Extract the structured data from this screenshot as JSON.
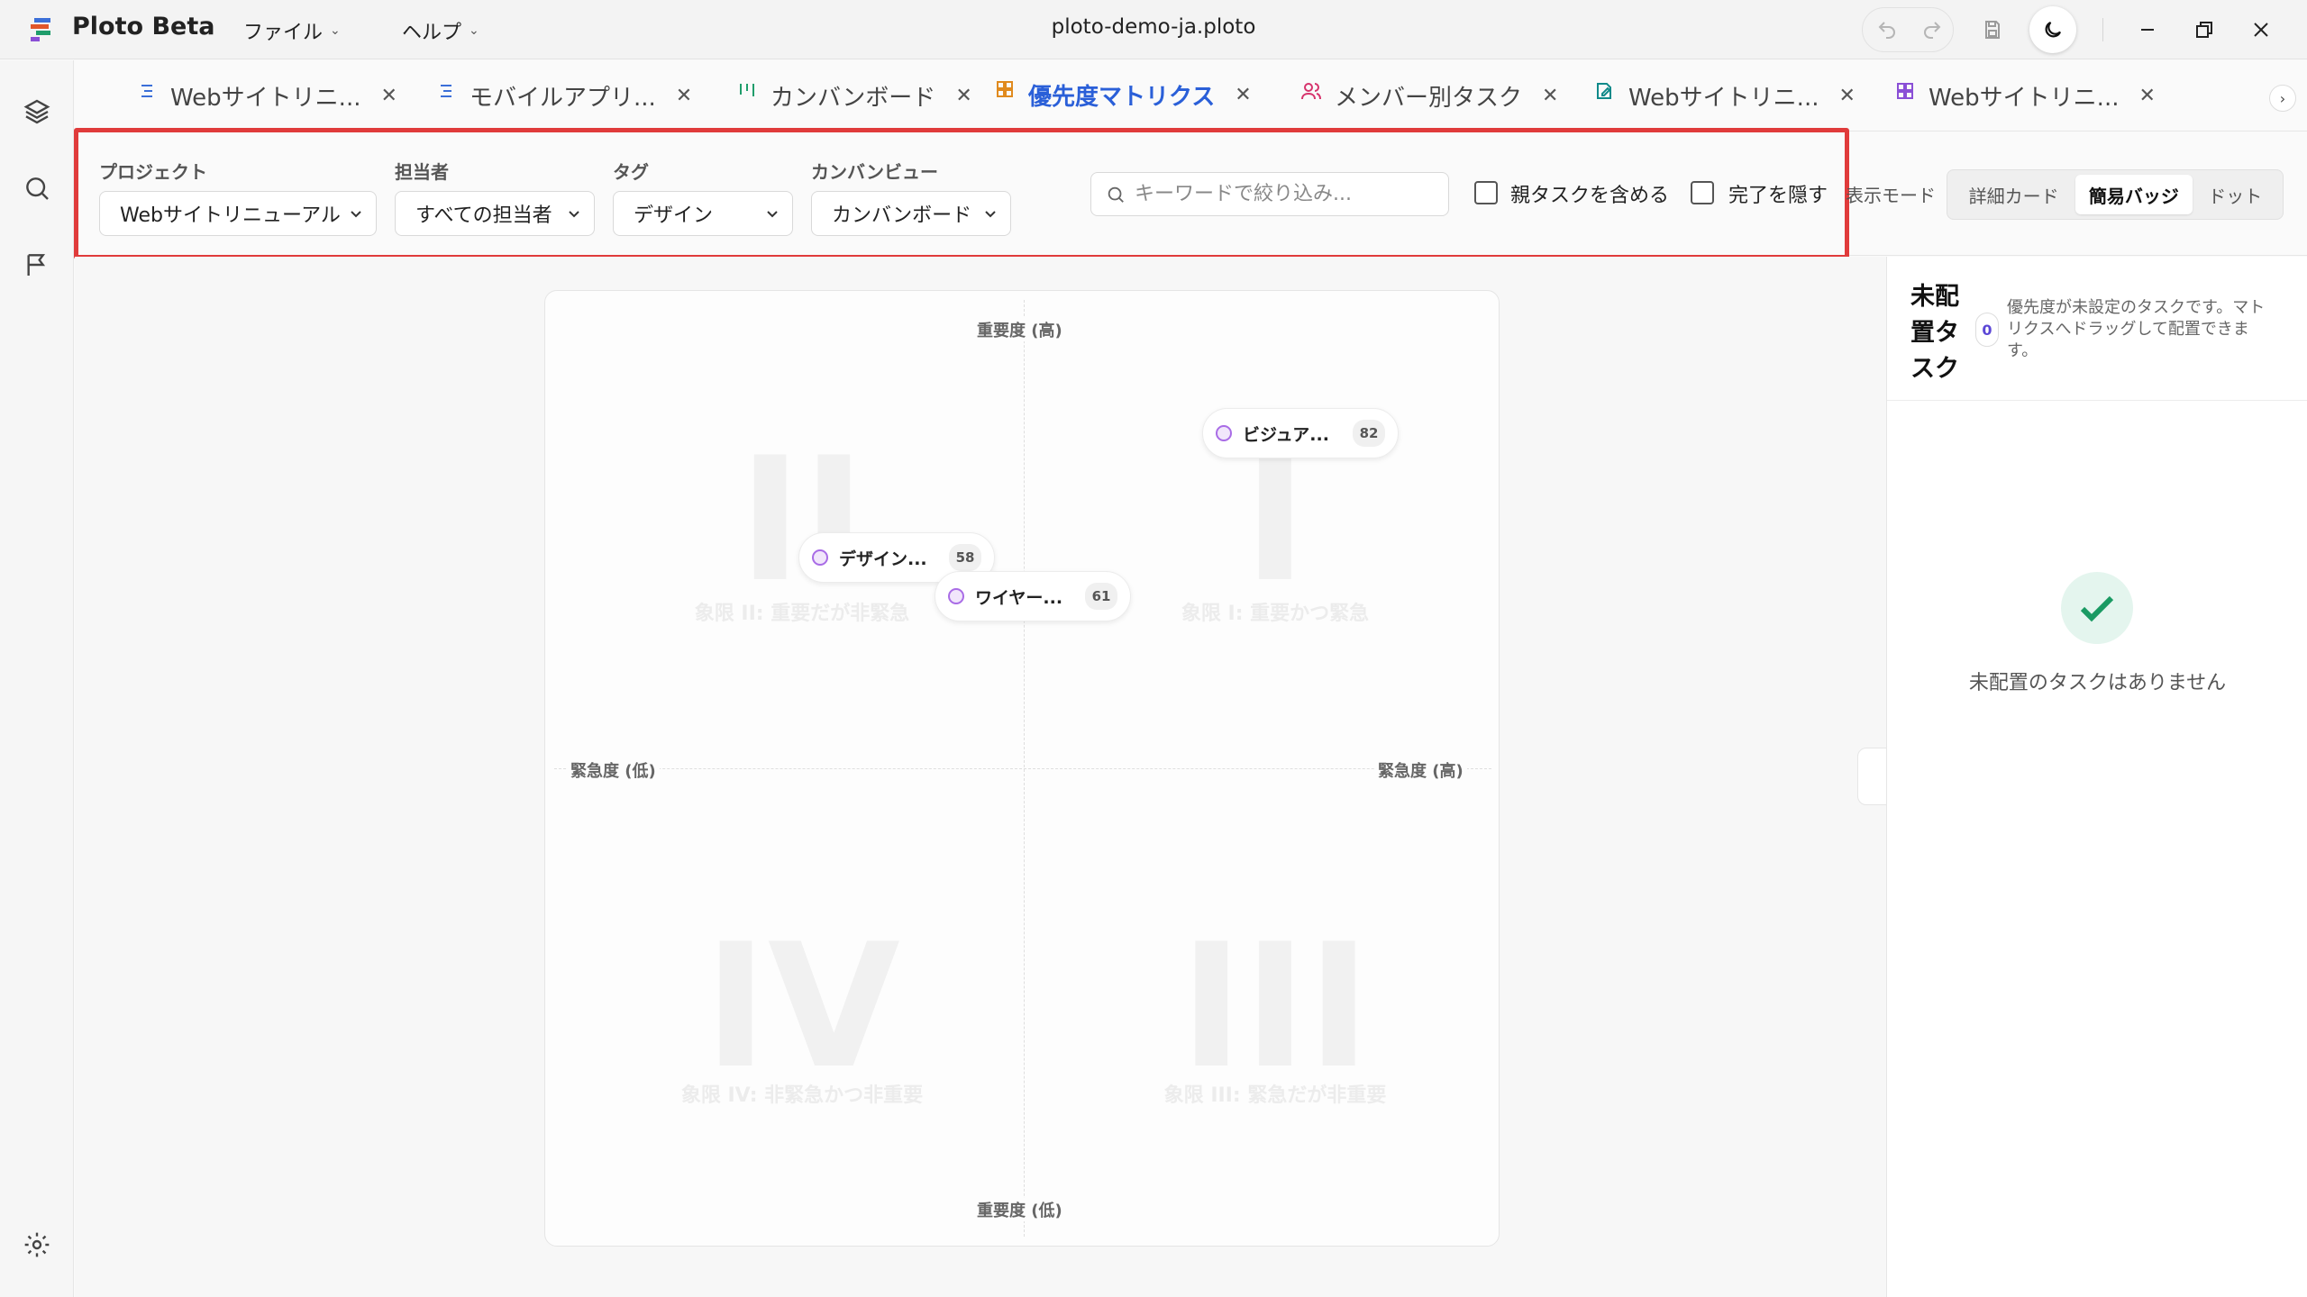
{
  "titlebar": {
    "app_name": "Ploto Beta",
    "menus": [
      "ファイル",
      "ヘルプ"
    ],
    "doc_title": "ploto-demo-ja.ploto"
  },
  "tabs": [
    {
      "label": "Webサイトリニ...",
      "icon": "list-icon",
      "color": "#3b6fd8",
      "active": false
    },
    {
      "label": "モバイルアプリ...",
      "icon": "list-icon",
      "color": "#3b6fd8",
      "active": false
    },
    {
      "label": "カンバンボード",
      "icon": "kanban-icon",
      "color": "#1f9d6b",
      "active": false
    },
    {
      "label": "優先度マトリクス",
      "icon": "grid-icon",
      "color": "#e08a1e",
      "active": true
    },
    {
      "label": "メンバー別タスク",
      "icon": "users-icon",
      "color": "#d6336c",
      "active": false
    },
    {
      "label": "Webサイトリニ...",
      "icon": "edit-doc-icon",
      "color": "#0f8a8a",
      "active": false
    },
    {
      "label": "Webサイトリニ...",
      "icon": "grid-icon",
      "color": "#8a4fd6",
      "active": false
    }
  ],
  "filters": {
    "project_label": "プロジェクト",
    "project_value": "Webサイトリニューアル",
    "assignee_label": "担当者",
    "assignee_value": "すべての担当者",
    "tag_label": "タグ",
    "tag_value": "デザイン",
    "kanban_label": "カンバンビュー",
    "kanban_value": "カンバンボード",
    "search_placeholder": "キーワードで絞り込み...",
    "include_parent": "親タスクを含める",
    "hide_done": "完了を隠す",
    "display_mode_label": "表示モード",
    "modes": [
      "詳細カード",
      "簡易バッジ",
      "ドット"
    ],
    "active_mode": "簡易バッジ"
  },
  "matrix": {
    "top": "重要度 (高)",
    "bottom": "重要度 (低)",
    "left": "緊急度 (低)",
    "right": "緊急度 (高)",
    "quadrants": [
      {
        "num": "II",
        "caption": "象限 II: 重要だが非緊急"
      },
      {
        "num": "I",
        "caption": "象限 I: 重要かつ緊急"
      },
      {
        "num": "IV",
        "caption": "象限 IV: 非緊急かつ非重要"
      },
      {
        "num": "III",
        "caption": "象限 III: 緊急だが非重要"
      }
    ],
    "tasks": [
      {
        "name": "ビジュア...",
        "score": "82"
      },
      {
        "name": "デザイン...",
        "score": "58"
      },
      {
        "name": "ワイヤー...",
        "score": "61"
      }
    ]
  },
  "panel": {
    "title": "未配置タスク",
    "count": "0",
    "description": "優先度が未設定のタスクです。マトリクスへドラッグして配置できます。",
    "empty_text": "未配置のタスクはありません"
  },
  "colors": {
    "accent": "#2a5fd8",
    "highlight": "#e03b3b",
    "success": "#1a9a63"
  }
}
